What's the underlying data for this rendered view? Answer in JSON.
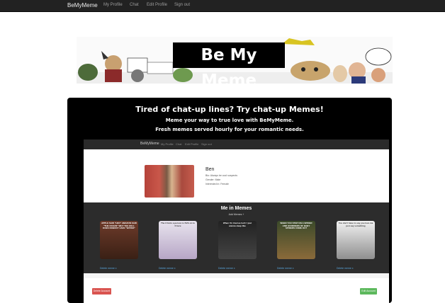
{
  "navbar": {
    "brand": "BeMyMeme",
    "links": [
      "My Profile",
      "Chat",
      "Edit Profile",
      "Sign out"
    ]
  },
  "banner": {
    "title": "Be My Meme"
  },
  "hero": {
    "tagline": "Tired of chat-up lines? Try chat-up Memes!",
    "line1": "Meme your way to true love with BeMyMeme.",
    "line2": "Fresh memes served hourly for your romantic needs."
  },
  "preview": {
    "brand": "BeMyMeme",
    "links": [
      "My Profile",
      "Chat",
      "Edit Profile",
      "Sign out"
    ],
    "profile": {
      "name": "Ben",
      "lines": [
        "Bio: Always be cool suspects",
        "Gender: Male",
        "Interested in: Female"
      ]
    },
    "memes": {
      "title": "Me in Memes",
      "subtitle": "Add Memes +",
      "items": [
        {
          "caption": "APPLE SAID \"H2O\" AMAZON SAID \"THE OCEAN\" WHY THE HELL DOES NOBODY HAVE \"WATER\"",
          "link": "Delete meme x"
        },
        {
          "caption": "The 3 fonts a person is SVG on to fi here",
          "link": "Delete meme x"
        },
        {
          "caption": "When I'm tired as hell / I just wanna sleep like",
          "link": "Delete meme x"
        },
        {
          "caption": "WHEN YOU STEP ON A SPIDER AND HUNDREDS OF BABY SPIDERS COME OUT",
          "link": "Delete meme x"
        },
        {
          "caption": "You don't have to say you love me just say something",
          "link": "Delete meme x"
        }
      ]
    },
    "delete_label": "Delete Account",
    "edit_label": "Edit Account"
  },
  "colors": {
    "navbar": "#222222",
    "panel": "#000000",
    "danger": "#d9534f",
    "success": "#5cb85c",
    "link": "#5aa8e0"
  }
}
